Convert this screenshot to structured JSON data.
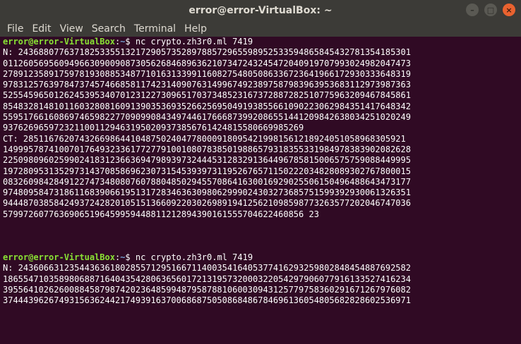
{
  "window": {
    "title": "error@error-VirtualBox: ~",
    "controls": {
      "minimize": "–",
      "maximize": "□",
      "close": "×"
    }
  },
  "menu": [
    "File",
    "Edit",
    "View",
    "Search",
    "Terminal",
    "Help"
  ],
  "block1": {
    "prompt_user": "error@error-VirtualBox",
    "prompt_sep": ":",
    "prompt_path": "~",
    "prompt_end": "$ ",
    "command": "nc crypto.zh3r0.ml 7419",
    "lines": [
      "N: 24368807763718253355132172905735289788572965598952533594865845432781354185301",
      "01126056956094966309009087305626846896362107347243245472040919707993024982047473",
      "27891235891759781930885348771016313399116082754805086336723641966172930333648319",
      "97831257639784737457466858117423140907631499674923897587983963953683112973987363",
      "52554596501262453953407012312273096517037348523167372887282510775963209467845861",
      "85483281481011603280816091390353693526625695049193855661090223062984351417648342",
      "55951766160869746598227709099084349744617666873992086551441209842638034251020249",
      "93762696597232110011294631950209373856761424815580669985269",
      "CT: 285116762074326698644104875024047780009180954219981561218924051058968305921",
      "14999578741007017649323361772779100108078385019886579318355331984978383902082628",
      "22509809602599024183123663694798939732444531283291364496785815006575759088449995",
      "19728095313529731437085869623073154539397311952676571150222034828089302767800015",
      "08326098428491227473480807607880485029455708641630016929025506150496488643473177",
      "97480958473186116839066195131728346363098062999024303273685751599392930061326351",
      "94448703858424937242820105151366092203026989194125621098598773263577202046747036",
      "57997260776369065196459959448811212894390161555704622460856 23"
    ]
  },
  "block2": {
    "prompt_user": "error@error-VirtualBox",
    "prompt_sep": ":",
    "prompt_path": "~",
    "prompt_end": "$ ",
    "command": "nc crypto.zh3r0.ml 7419",
    "lines": [
      "N: 24360663123544363618028557129516671140035416405377416293259802848454887692582",
      "18655471035898068871640435428063656017213195732000322054297906077916133527416234",
      "39556410262600884587987420236485994879587881060030943125779758360291671267976082",
      "37444396267493156362442174939163700686875050868486784696136054805682828602536971"
    ]
  }
}
